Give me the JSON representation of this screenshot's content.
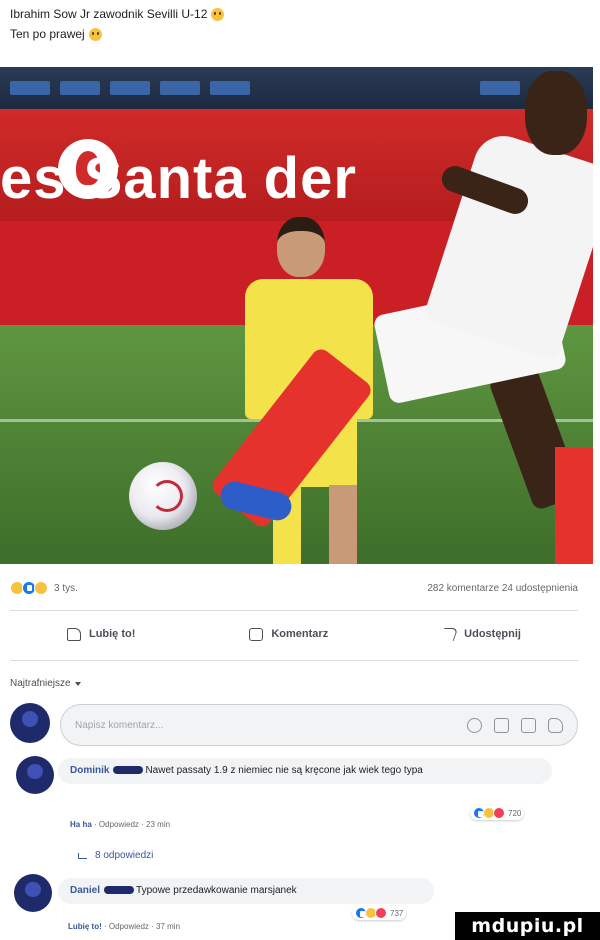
{
  "post": {
    "line1": "Ibrahim Sow Jr zawodnik Sevilli U-12",
    "line2": "Ten po prawej"
  },
  "photo": {
    "banner_text": "es Santa der"
  },
  "stats": {
    "reaction_count": "3 tys.",
    "comments_shares": "282 komentarze 24 udostępnienia"
  },
  "actions": {
    "like": "Lubię to!",
    "comment": "Komentarz",
    "share": "Udostępnij"
  },
  "sort": {
    "label": "Najtrafniejsze"
  },
  "comment_input": {
    "placeholder": "Napisz komentarz..."
  },
  "comments": [
    {
      "author": "Dominik",
      "text": "Nawet passaty 1.9 z niemiec nie są kręcone jak wiek tego typa",
      "meta_a": "Ha ha",
      "meta_b": "Odpowiedz · 23 min",
      "reaction_count": "720",
      "replies_label": "8 odpowiedzi"
    },
    {
      "author": "Daniel",
      "text": "Typowe przedawkowanie marsjanek",
      "meta_a": "Lubię to!",
      "meta_b": "Odpowiedz · 37 min",
      "reaction_count": "737"
    }
  ],
  "watermark": {
    "text": "mdupiu.pl"
  },
  "colors": {
    "link": "#385898",
    "like_blue": "#1877f2",
    "banner_red": "#c91f25",
    "bubble_bg": "#f2f3f5"
  },
  "icons": [
    "emoji-icon",
    "like-reaction-icon",
    "haha-reaction-icon",
    "wow-reaction-icon",
    "love-reaction-icon",
    "thumb-up-icon",
    "comment-icon",
    "share-icon",
    "smile-icon",
    "camera-icon",
    "gif-icon",
    "sticker-icon",
    "reply-arrow-icon"
  ]
}
